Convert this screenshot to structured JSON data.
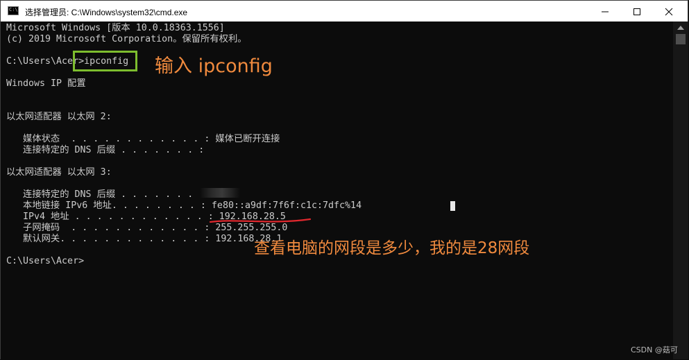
{
  "window": {
    "title": "选择管理员: C:\\Windows\\system32\\cmd.exe",
    "icon_text": "C:\\"
  },
  "console": {
    "lines": [
      "Microsoft Windows [版本 10.0.18363.1556]",
      "(c) 2019 Microsoft Corporation。保留所有权利。",
      "",
      "C:\\Users\\Acer>ipconfig",
      "",
      "Windows IP 配置",
      "",
      "",
      "以太网适配器 以太网 2:",
      "",
      "   媒体状态  . . . . . . . . . . . . : 媒体已断开连接",
      "   连接特定的 DNS 后缀 . . . . . . . :",
      "",
      "以太网适配器 以太网 3:",
      "",
      "   连接特定的 DNS 后缀 . . . . . . . :",
      "   本地链接 IPv6 地址. . . . . . . . : fe80::a9df:7f6f:c1c:7dfc%14",
      "   IPv4 地址 . . . . . . . . . . . . : 192.168.28.5",
      "   子网掩码  . . . . . . . . . . . . : 255.255.255.0",
      "   默认网关. . . . . . . . . . . . . : 192.168.28.1",
      "",
      "C:\\Users\\Acer>"
    ]
  },
  "annotations": {
    "command_note": "输入 ipconfig",
    "segment_note": "查看电脑的网段是多少，我的是28网段",
    "color": "#f08a3e",
    "box_color": "#7dbd2e",
    "underline_color": "#e0282e"
  },
  "watermark": "CSDN @菇可",
  "icons": {
    "minimize": "minimize-icon",
    "maximize": "maximize-icon",
    "close": "close-icon",
    "scroll_up": "chevron-up-icon"
  }
}
